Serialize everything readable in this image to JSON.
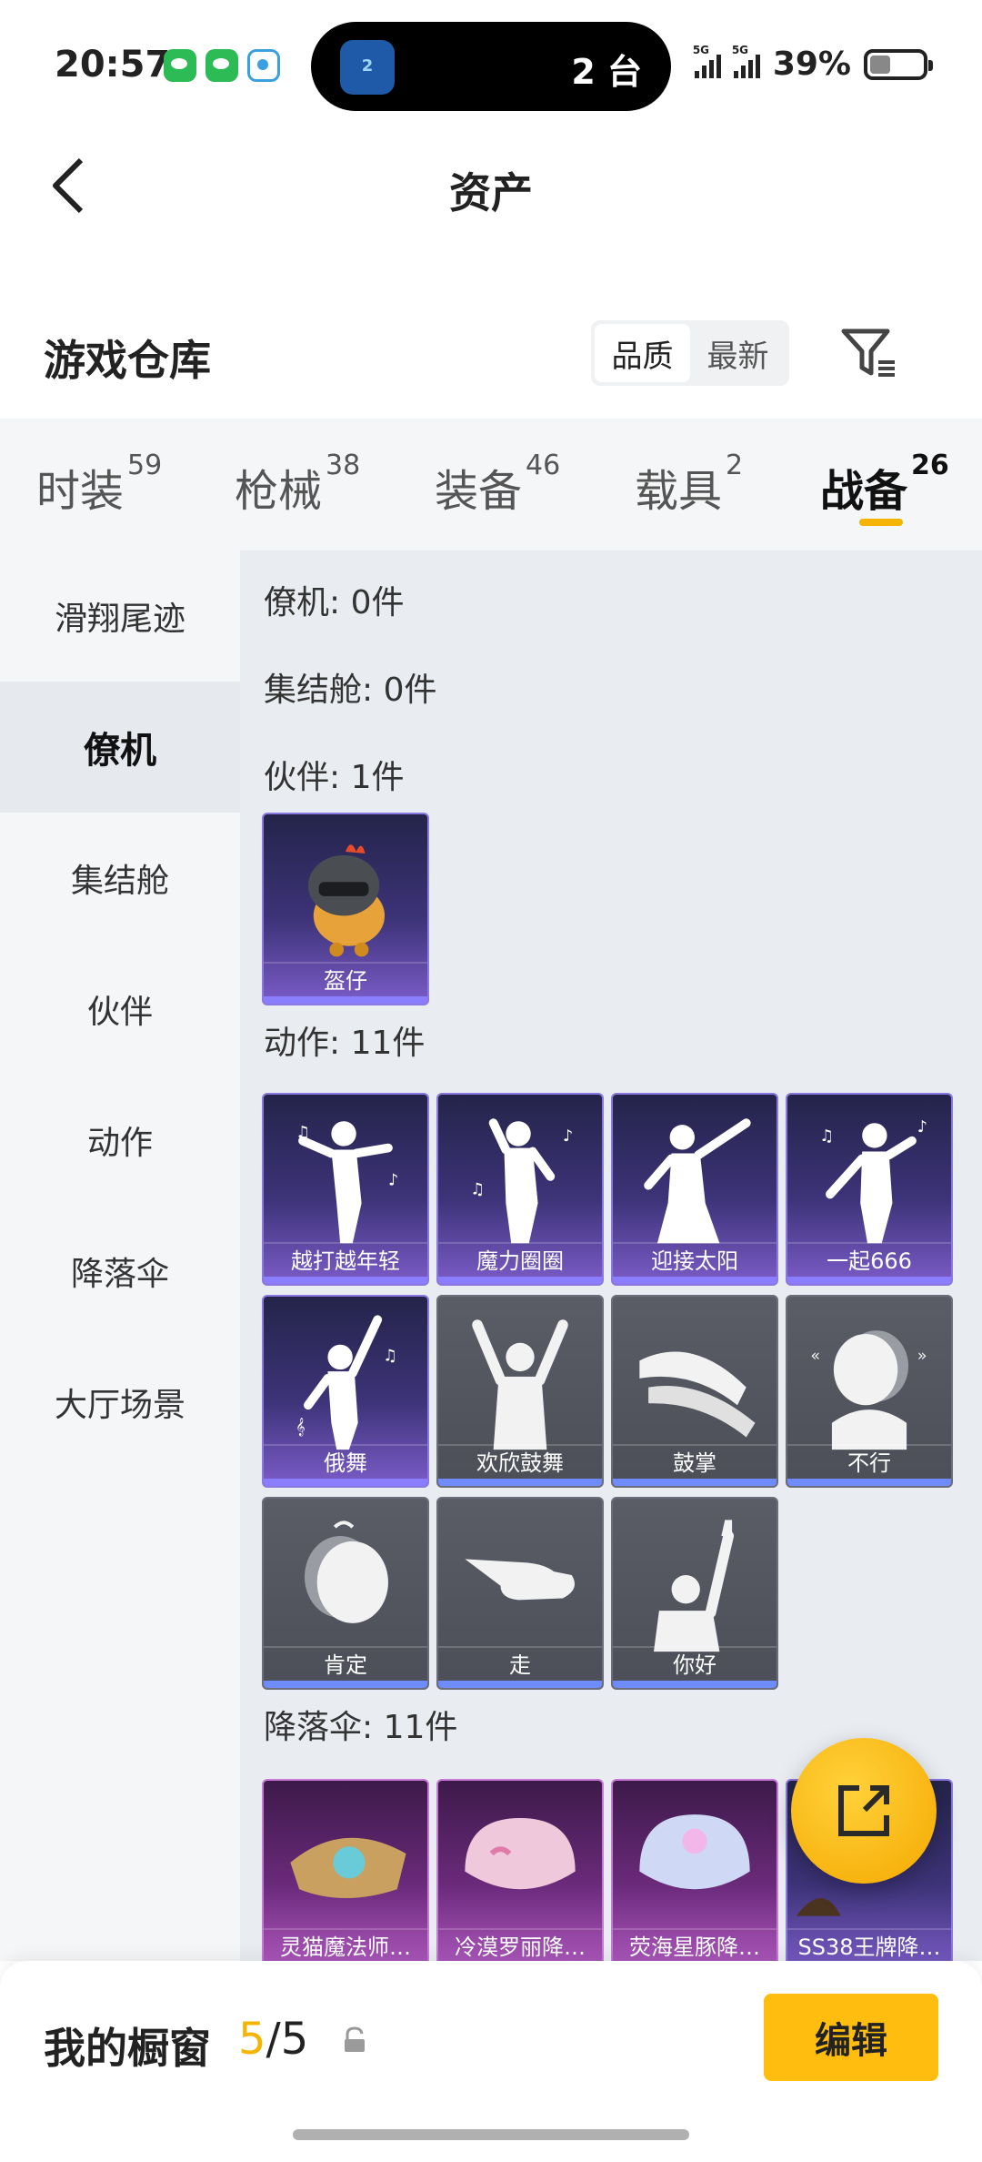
{
  "status_bar": {
    "time": "20:57",
    "island_app_badge": "2",
    "island_text": "2 台",
    "network_1": "5G",
    "network_2": "5G",
    "battery_pct": "39%"
  },
  "nav": {
    "title": "资产"
  },
  "section": {
    "title": "游戏仓库",
    "sort_options": [
      "品质",
      "最新"
    ],
    "active_sort": "品质"
  },
  "tabs": [
    {
      "label": "时装",
      "count": "59"
    },
    {
      "label": "枪械",
      "count": "38"
    },
    {
      "label": "装备",
      "count": "46"
    },
    {
      "label": "载具",
      "count": "2"
    },
    {
      "label": "战备",
      "count": "26"
    }
  ],
  "active_tab": "战备",
  "sidebar": [
    "滑翔尾迹",
    "僚机",
    "集结舱",
    "伙伴",
    "动作",
    "降落伞",
    "大厅场景"
  ],
  "active_sidebar": "僚机",
  "categories": {
    "wingman": "僚机: 0件",
    "rally_pod": "集结舱: 0件",
    "partner": "伙伴: 1件",
    "action": "动作: 11件",
    "parachute": "降落伞: 11件"
  },
  "partner_items": [
    "盔仔"
  ],
  "action_items": [
    "越打越年轻",
    "魔力圈圈",
    "迎接太阳",
    "一起666",
    "俄舞",
    "欢欣鼓舞",
    "鼓掌",
    "不行",
    "肯定",
    "走",
    "你好"
  ],
  "parachute_items": [
    "灵猫魔法师…",
    "冷漠罗丽降…",
    "荧海星豚降…",
    "SS38王牌降…"
  ],
  "bottom": {
    "label": "我的橱窗",
    "count_current": "5",
    "count_sep": "/",
    "count_total": "5",
    "edit_label": "编辑"
  }
}
